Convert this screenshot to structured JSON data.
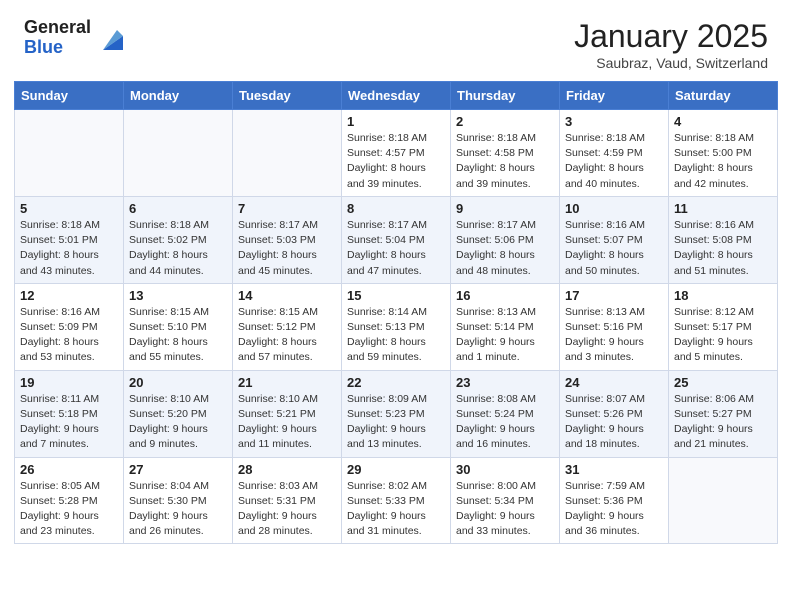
{
  "logo": {
    "general": "General",
    "blue": "Blue"
  },
  "title": "January 2025",
  "location": "Saubraz, Vaud, Switzerland",
  "days_of_week": [
    "Sunday",
    "Monday",
    "Tuesday",
    "Wednesday",
    "Thursday",
    "Friday",
    "Saturday"
  ],
  "weeks": [
    [
      {
        "day": "",
        "info": ""
      },
      {
        "day": "",
        "info": ""
      },
      {
        "day": "",
        "info": ""
      },
      {
        "day": "1",
        "info": "Sunrise: 8:18 AM\nSunset: 4:57 PM\nDaylight: 8 hours\nand 39 minutes."
      },
      {
        "day": "2",
        "info": "Sunrise: 8:18 AM\nSunset: 4:58 PM\nDaylight: 8 hours\nand 39 minutes."
      },
      {
        "day": "3",
        "info": "Sunrise: 8:18 AM\nSunset: 4:59 PM\nDaylight: 8 hours\nand 40 minutes."
      },
      {
        "day": "4",
        "info": "Sunrise: 8:18 AM\nSunset: 5:00 PM\nDaylight: 8 hours\nand 42 minutes."
      }
    ],
    [
      {
        "day": "5",
        "info": "Sunrise: 8:18 AM\nSunset: 5:01 PM\nDaylight: 8 hours\nand 43 minutes."
      },
      {
        "day": "6",
        "info": "Sunrise: 8:18 AM\nSunset: 5:02 PM\nDaylight: 8 hours\nand 44 minutes."
      },
      {
        "day": "7",
        "info": "Sunrise: 8:17 AM\nSunset: 5:03 PM\nDaylight: 8 hours\nand 45 minutes."
      },
      {
        "day": "8",
        "info": "Sunrise: 8:17 AM\nSunset: 5:04 PM\nDaylight: 8 hours\nand 47 minutes."
      },
      {
        "day": "9",
        "info": "Sunrise: 8:17 AM\nSunset: 5:06 PM\nDaylight: 8 hours\nand 48 minutes."
      },
      {
        "day": "10",
        "info": "Sunrise: 8:16 AM\nSunset: 5:07 PM\nDaylight: 8 hours\nand 50 minutes."
      },
      {
        "day": "11",
        "info": "Sunrise: 8:16 AM\nSunset: 5:08 PM\nDaylight: 8 hours\nand 51 minutes."
      }
    ],
    [
      {
        "day": "12",
        "info": "Sunrise: 8:16 AM\nSunset: 5:09 PM\nDaylight: 8 hours\nand 53 minutes."
      },
      {
        "day": "13",
        "info": "Sunrise: 8:15 AM\nSunset: 5:10 PM\nDaylight: 8 hours\nand 55 minutes."
      },
      {
        "day": "14",
        "info": "Sunrise: 8:15 AM\nSunset: 5:12 PM\nDaylight: 8 hours\nand 57 minutes."
      },
      {
        "day": "15",
        "info": "Sunrise: 8:14 AM\nSunset: 5:13 PM\nDaylight: 8 hours\nand 59 minutes."
      },
      {
        "day": "16",
        "info": "Sunrise: 8:13 AM\nSunset: 5:14 PM\nDaylight: 9 hours\nand 1 minute."
      },
      {
        "day": "17",
        "info": "Sunrise: 8:13 AM\nSunset: 5:16 PM\nDaylight: 9 hours\nand 3 minutes."
      },
      {
        "day": "18",
        "info": "Sunrise: 8:12 AM\nSunset: 5:17 PM\nDaylight: 9 hours\nand 5 minutes."
      }
    ],
    [
      {
        "day": "19",
        "info": "Sunrise: 8:11 AM\nSunset: 5:18 PM\nDaylight: 9 hours\nand 7 minutes."
      },
      {
        "day": "20",
        "info": "Sunrise: 8:10 AM\nSunset: 5:20 PM\nDaylight: 9 hours\nand 9 minutes."
      },
      {
        "day": "21",
        "info": "Sunrise: 8:10 AM\nSunset: 5:21 PM\nDaylight: 9 hours\nand 11 minutes."
      },
      {
        "day": "22",
        "info": "Sunrise: 8:09 AM\nSunset: 5:23 PM\nDaylight: 9 hours\nand 13 minutes."
      },
      {
        "day": "23",
        "info": "Sunrise: 8:08 AM\nSunset: 5:24 PM\nDaylight: 9 hours\nand 16 minutes."
      },
      {
        "day": "24",
        "info": "Sunrise: 8:07 AM\nSunset: 5:26 PM\nDaylight: 9 hours\nand 18 minutes."
      },
      {
        "day": "25",
        "info": "Sunrise: 8:06 AM\nSunset: 5:27 PM\nDaylight: 9 hours\nand 21 minutes."
      }
    ],
    [
      {
        "day": "26",
        "info": "Sunrise: 8:05 AM\nSunset: 5:28 PM\nDaylight: 9 hours\nand 23 minutes."
      },
      {
        "day": "27",
        "info": "Sunrise: 8:04 AM\nSunset: 5:30 PM\nDaylight: 9 hours\nand 26 minutes."
      },
      {
        "day": "28",
        "info": "Sunrise: 8:03 AM\nSunset: 5:31 PM\nDaylight: 9 hours\nand 28 minutes."
      },
      {
        "day": "29",
        "info": "Sunrise: 8:02 AM\nSunset: 5:33 PM\nDaylight: 9 hours\nand 31 minutes."
      },
      {
        "day": "30",
        "info": "Sunrise: 8:00 AM\nSunset: 5:34 PM\nDaylight: 9 hours\nand 33 minutes."
      },
      {
        "day": "31",
        "info": "Sunrise: 7:59 AM\nSunset: 5:36 PM\nDaylight: 9 hours\nand 36 minutes."
      },
      {
        "day": "",
        "info": ""
      }
    ]
  ]
}
